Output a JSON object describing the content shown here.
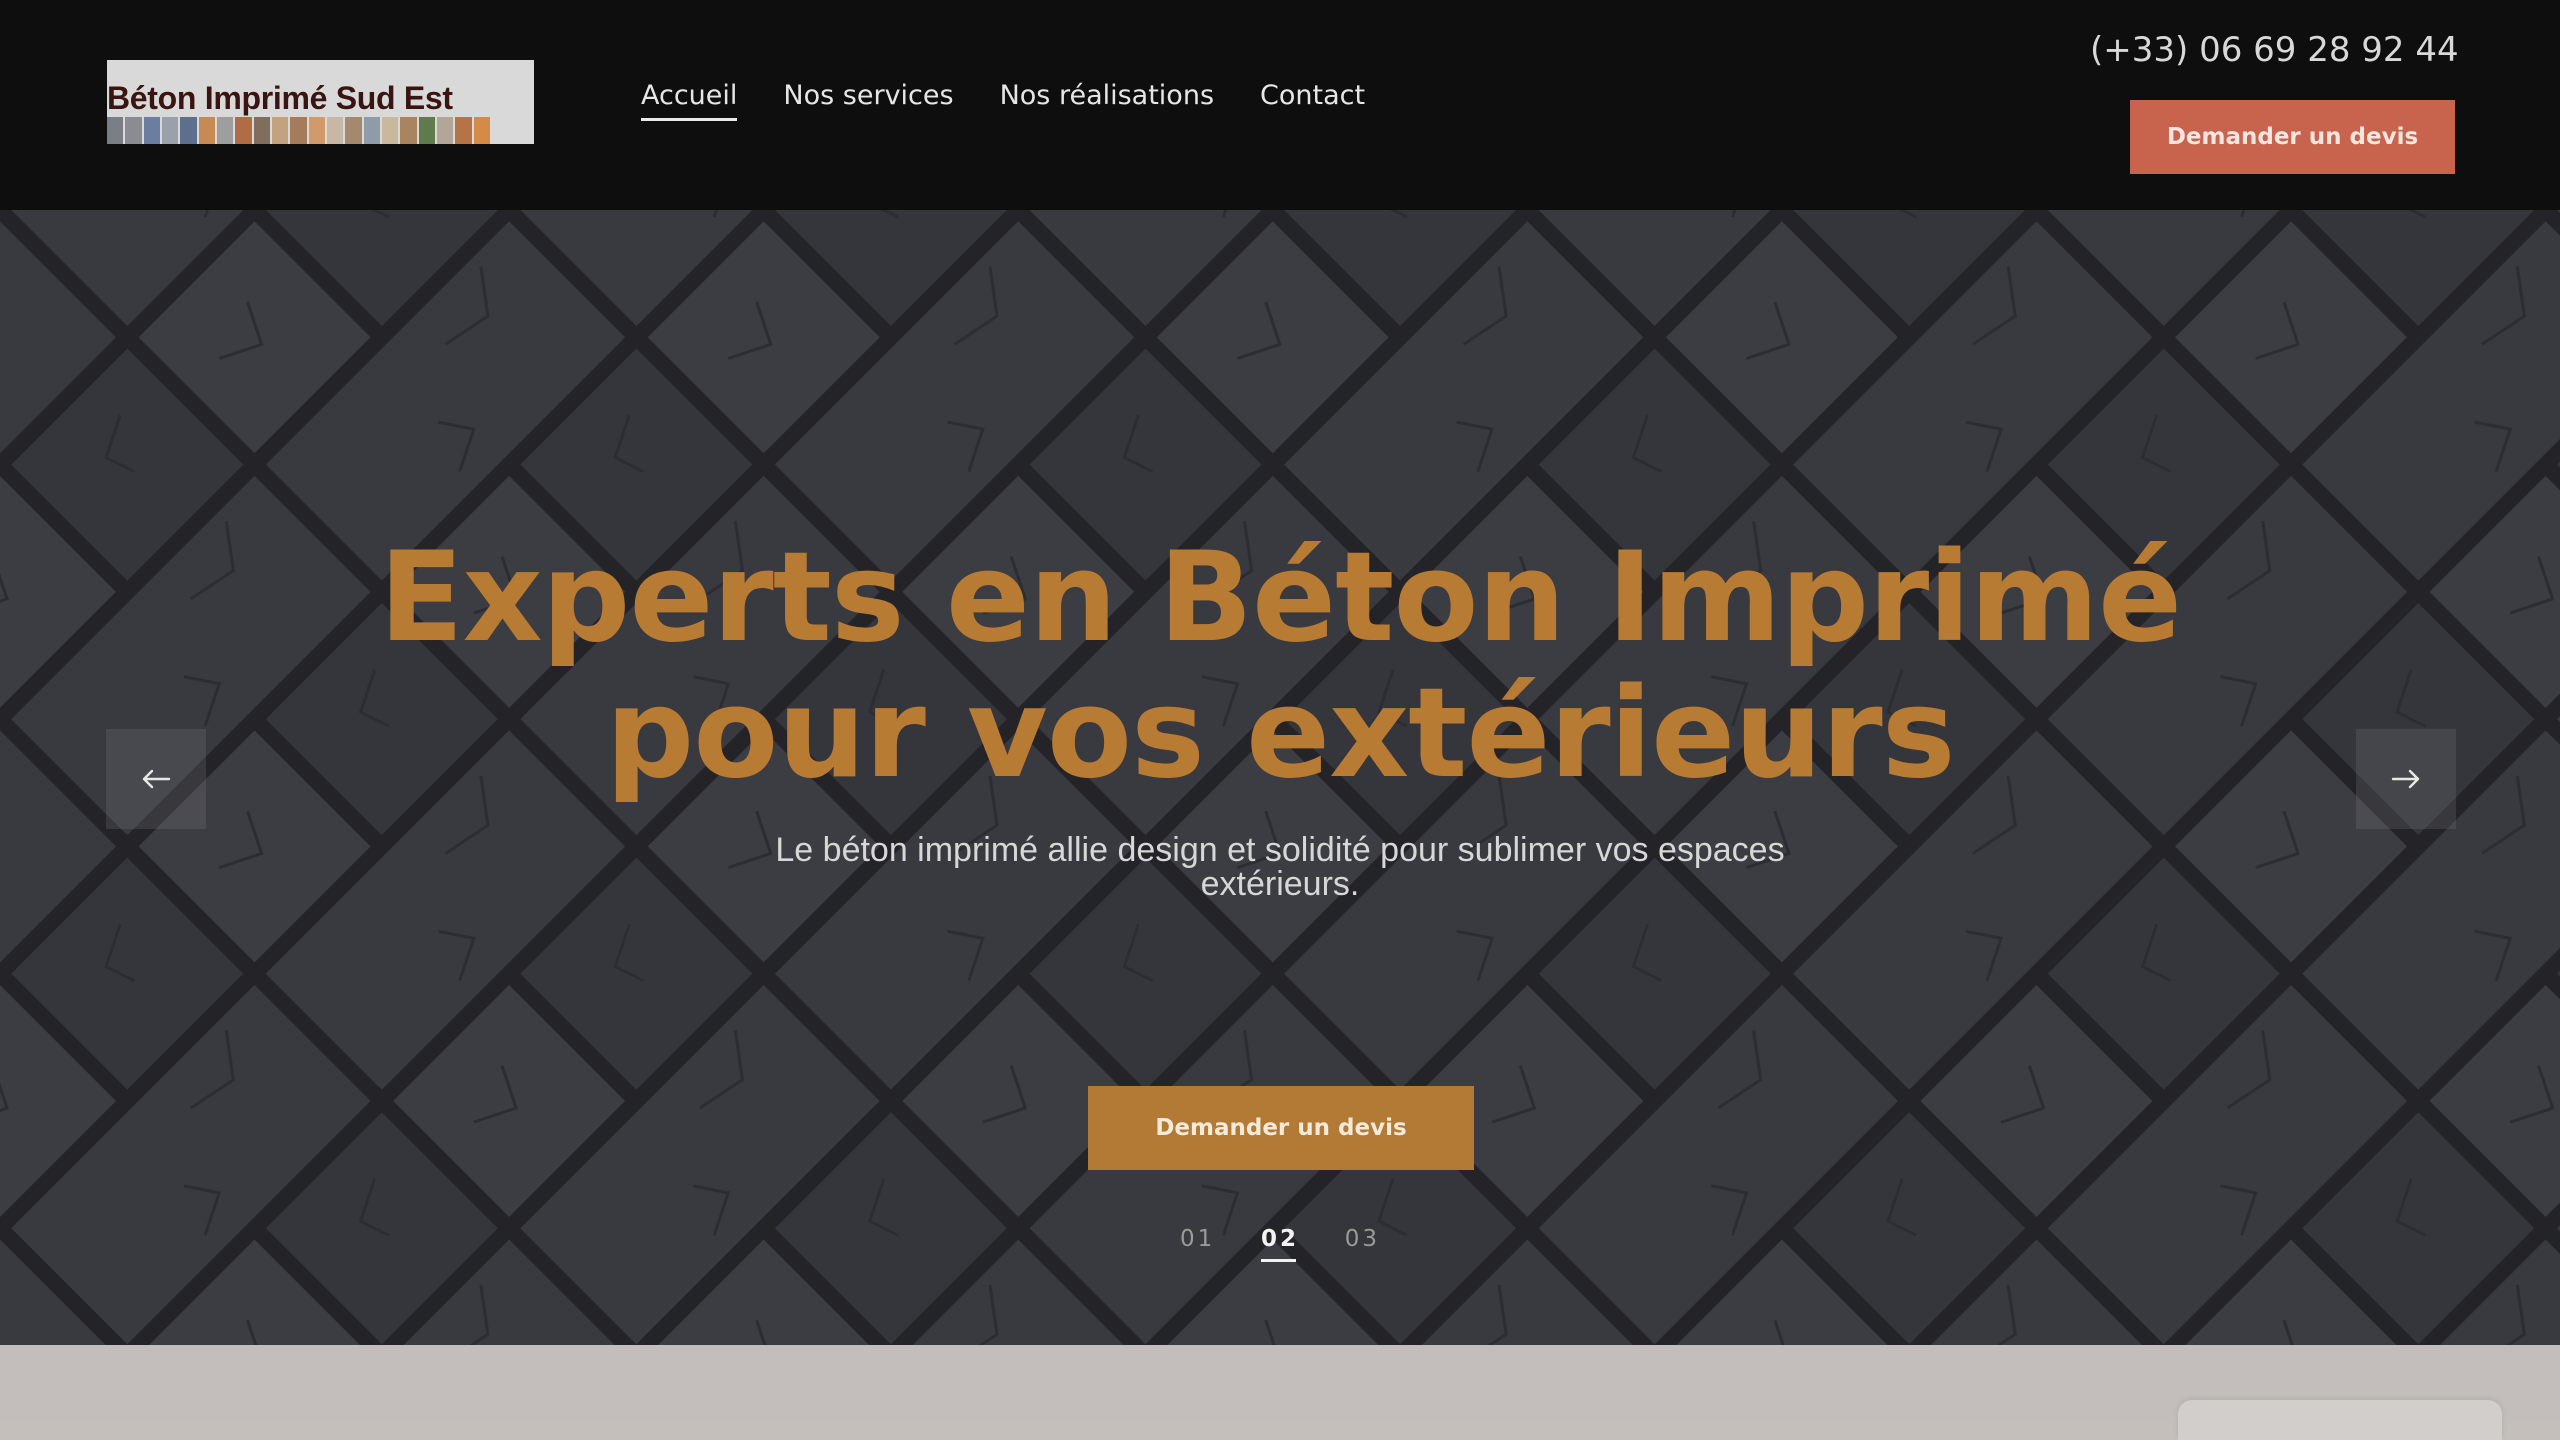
{
  "header": {
    "logo_text": "Béton Imprimé Sud Est",
    "logo_tile_colors": [
      "#7a7f86",
      "#8a8c92",
      "#6b7ea0",
      "#9ba1aa",
      "#5d6f8c",
      "#c88a55",
      "#9e9e9e",
      "#b06c45",
      "#7f6e5c",
      "#c3a27f",
      "#a47c5c",
      "#d09a6a",
      "#c7b7a5",
      "#a38a6f",
      "#8e9ba8",
      "#c8b89c",
      "#a88460",
      "#5f7a4c",
      "#b2a699",
      "#b57446",
      "#d48a48"
    ],
    "nav": [
      {
        "label": "Accueil",
        "active": true
      },
      {
        "label": "Nos services",
        "active": false
      },
      {
        "label": "Nos réalisations",
        "active": false
      },
      {
        "label": "Contact",
        "active": false
      }
    ],
    "phone": "(+33) 06 69 28 92 44",
    "cta_label": "Demander un devis"
  },
  "hero": {
    "title_line1": "Experts en Béton Imprimé",
    "title_line2": "pour vos extérieurs",
    "subtitle_line1": "Le béton imprimé allie design et solidité pour sublimer vos espaces",
    "subtitle_line2": "extérieurs.",
    "cta_label": "Demander un devis",
    "prev_icon": "arrow-left-icon",
    "next_icon": "arrow-right-icon",
    "slides": [
      {
        "label": "01",
        "active": false
      },
      {
        "label": "02",
        "active": true
      },
      {
        "label": "03",
        "active": false
      }
    ]
  },
  "colors": {
    "header_bg": "#0e0e0f",
    "header_cta": "#c8644d",
    "hero_accent": "#b87b34",
    "hero_cta": "#b27a35",
    "below_bg": "#c3bebb"
  }
}
